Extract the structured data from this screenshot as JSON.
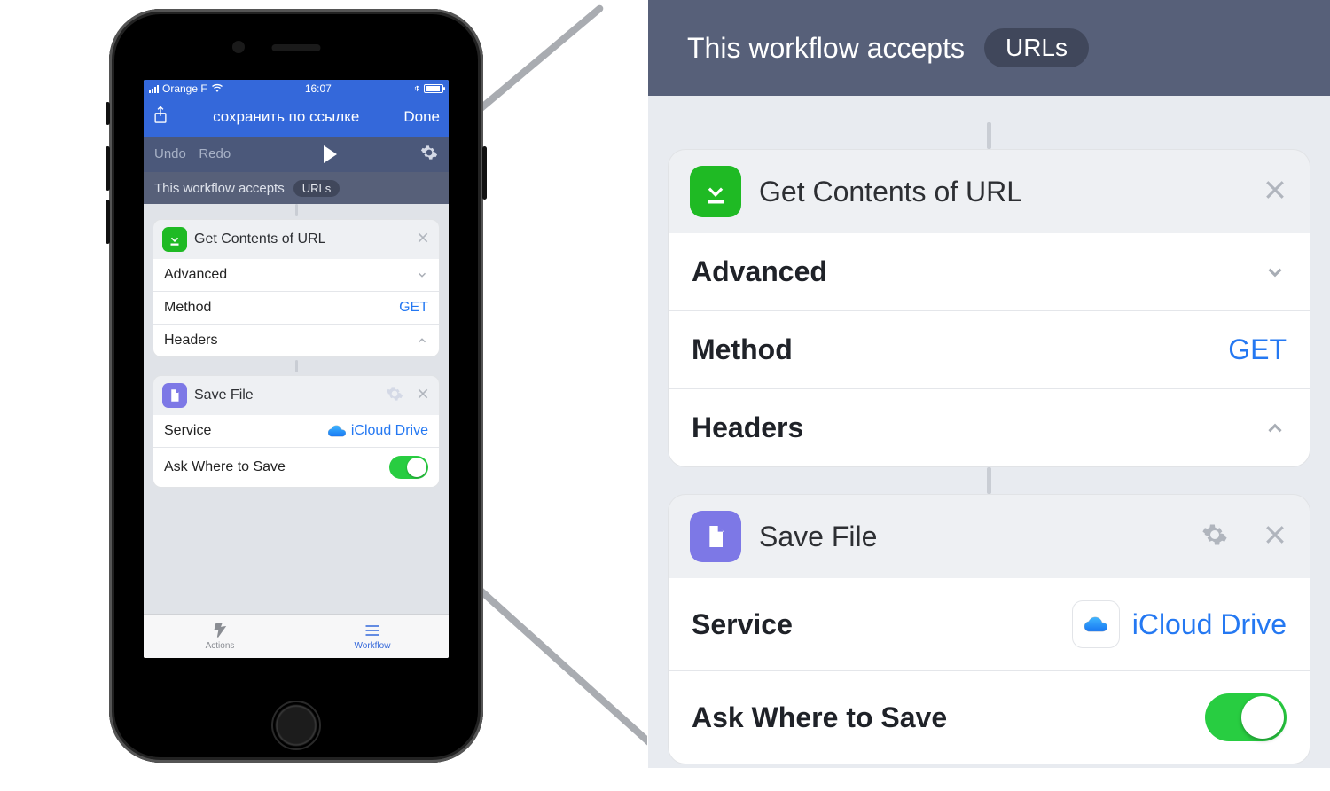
{
  "statusbar": {
    "carrier": "Orange F",
    "time": "16:07"
  },
  "navbar": {
    "title": "сохранить по ссылке",
    "done": "Done"
  },
  "toolbar": {
    "undo": "Undo",
    "redo": "Redo"
  },
  "accepts": {
    "label": "This workflow accepts",
    "chip": "URLs"
  },
  "actions": {
    "getContents": {
      "title": "Get Contents of URL",
      "advanced": "Advanced",
      "methodLabel": "Method",
      "methodValue": "GET",
      "headers": "Headers"
    },
    "saveFile": {
      "title": "Save File",
      "serviceLabel": "Service",
      "serviceValue": "iCloud Drive",
      "askLabel": "Ask Where to Save",
      "askValue": true
    }
  },
  "tabs": {
    "actions": "Actions",
    "workflow": "Workflow"
  }
}
